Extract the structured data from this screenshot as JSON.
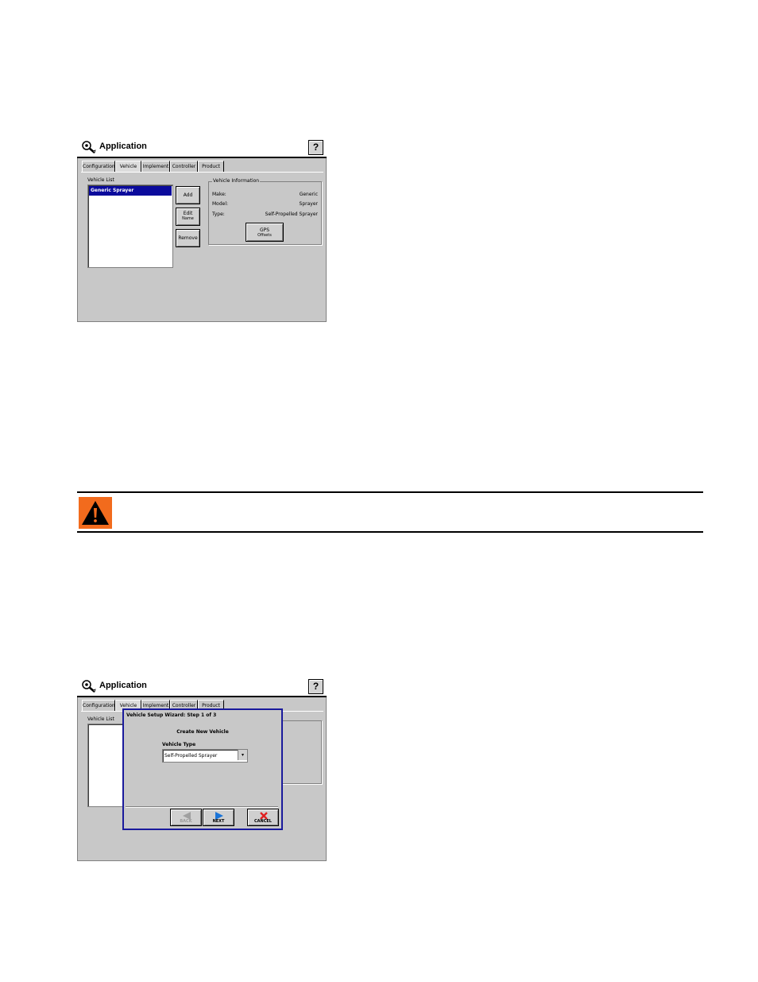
{
  "screen1": {
    "app_title": "Application",
    "help_label": "?",
    "tabs": [
      "Configuration",
      "Vehicle",
      "Implement",
      "Controller",
      "Product"
    ],
    "active_tab": "Vehicle",
    "vehicle_list_label": "Vehicle List",
    "vehicle_list_items": [
      "Generic Sprayer"
    ],
    "buttons": {
      "add": "Add",
      "edit_line1": "Edit",
      "edit_line2": "Name",
      "remove": "Remove"
    },
    "vehicle_info": {
      "title": "Vehicle Information",
      "make_label": "Make:",
      "make_value": "Generic",
      "model_label": "Model:",
      "model_value": "Sprayer",
      "type_label": "Type:",
      "type_value": "Self-Propelled Sprayer",
      "gps_line1": "GPS",
      "gps_line2": "Offsets"
    }
  },
  "screen2": {
    "app_title": "Application",
    "help_label": "?",
    "tabs": [
      "Configuration",
      "Vehicle",
      "Implement",
      "Controller",
      "Product"
    ],
    "active_tab": "Vehicle",
    "vehicle_list_label": "Vehicle List",
    "wizard": {
      "title": "Vehicle Setup Wizard:  Step 1 of 3",
      "heading": "Create New Vehicle",
      "vehicle_type_label": "Vehicle Type",
      "vehicle_type_value": "Self-Propelled Sprayer",
      "back_label": "BACK",
      "next_label": "NEXT",
      "cancel_label": "CANCEL"
    }
  },
  "colors": {
    "selection_blue": "#0a0a9c",
    "dialog_border": "#1a1a9c",
    "warning_orange": "#f26b1d",
    "panel_gray": "#c8c8c8"
  }
}
